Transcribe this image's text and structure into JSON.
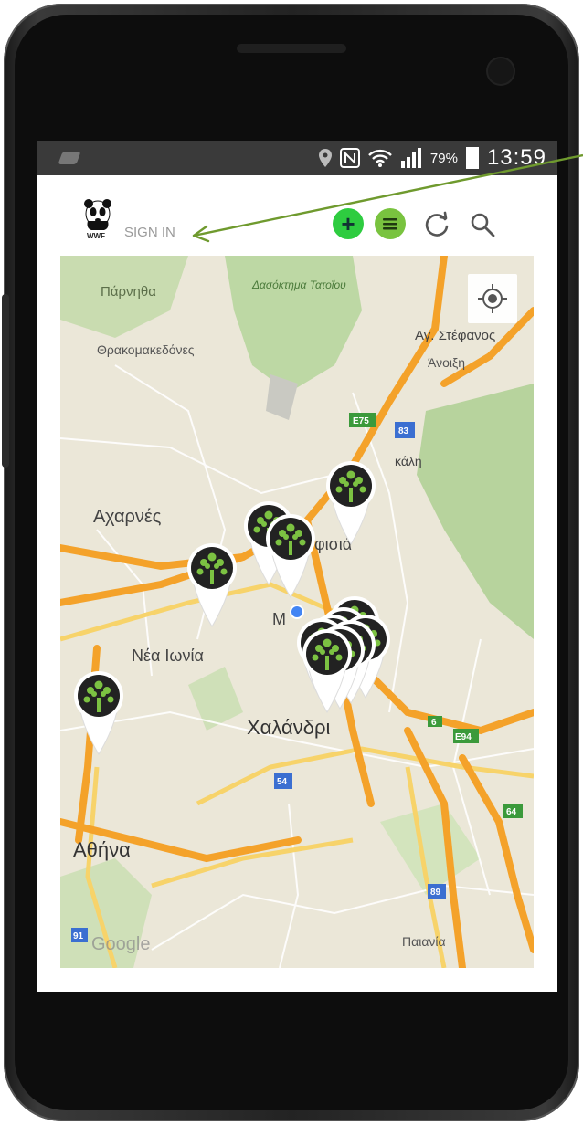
{
  "status_bar": {
    "battery_percent": "79%",
    "time": "13:59",
    "icons": [
      "location-pin-icon",
      "nfc-icon",
      "wifi-icon",
      "signal-icon",
      "battery-icon"
    ]
  },
  "app_bar": {
    "logo_text": "WWF",
    "sign_in_label": "SIGN IN",
    "add_icon_glyph": "+",
    "icons": [
      "panda-logo-icon",
      "add-icon",
      "menu-icon",
      "refresh-icon",
      "search-icon"
    ],
    "add_color": "#2ecc40",
    "menu_color": "#79c33f"
  },
  "map": {
    "places": {
      "parnitha": "Πάρνηθα",
      "tatoi": "Δασόκτημα Τατοΐου",
      "thrakomakedones": "Θρακομακεδόνες",
      "agios_stefanos": "Αγ. Στέφανος",
      "anoixi": "Άνοιξη",
      "ekali": "κάλη",
      "acharnes": "Αχαρνές",
      "kifisia": "φισιά",
      "marousi_abbr": "M",
      "nea_ionia": "Νέα Ιωνία",
      "chalandri": "Χαλάνδρι",
      "athina": "Αθήνα",
      "paiania": "Παιανία",
      "google": "Google"
    },
    "road_shields": [
      "E75",
      "83",
      "6",
      "E94",
      "54",
      "64",
      "89",
      "91"
    ],
    "marker_color": "#222222",
    "tree_color": "#7cc242",
    "locate_icon": "my-location-icon"
  }
}
